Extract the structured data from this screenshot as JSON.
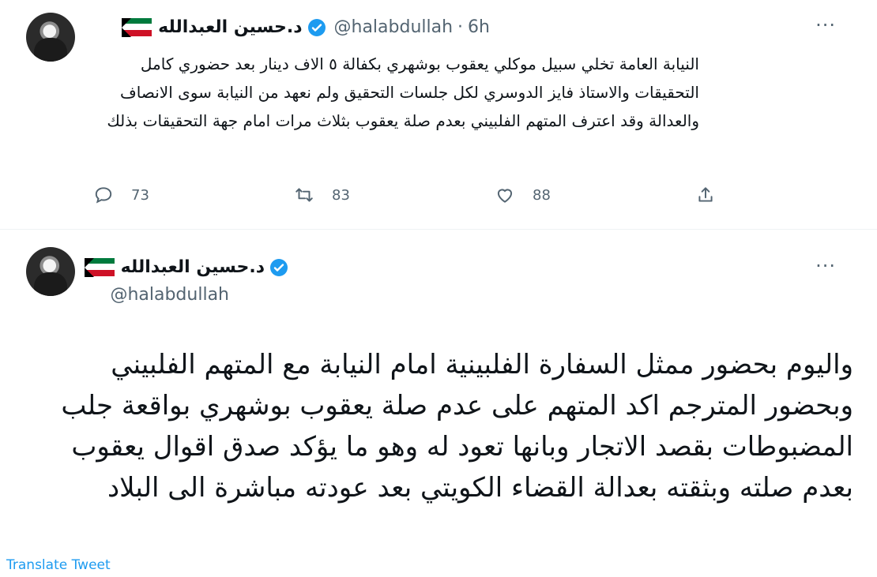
{
  "tweets": [
    {
      "author": {
        "display_name": "د.حسين العبدالله",
        "handle": "@halabdullah"
      },
      "separator": "·",
      "time": "6h",
      "text": "النيابة العامة تخلي سبيل موكلي يعقوب بوشهري بكفالة ٥ الاف دينار بعد حضوري كامل التحقيقات والاستاذ فايز الدوسري لكل جلسات التحقيق ولم نعهد من النيابة سوى الانصاف والعدالة وقد اعترف المتهم الفلبيني بعدم صلة يعقوب بثلاث مرات امام جهة التحقيقات بذلك",
      "actions": {
        "replies": "73",
        "retweets": "83",
        "likes": "88"
      }
    },
    {
      "author": {
        "display_name": "د.حسين العبدالله",
        "handle": "@halabdullah"
      },
      "text": "واليوم بحضور ممثل السفارة الفلبينية امام النيابة مع المتهم الفلبيني وبحضور المترجم اكد المتهم على عدم صلة يعقوب بوشهري بواقعة جلب المضبوطات بقصد الاتجار وبانها تعود له وهو ما يؤكد صدق اقوال يعقوب بعدم صلته وبثقته بعدالة القضاء الكويتي بعد عودته مباشرة الى البلاد",
      "translate_label": "Translate Tweet"
    }
  ],
  "colors": {
    "verified": "#1d9bf0",
    "secondary_text": "#536471",
    "link": "#1d9bf0"
  }
}
